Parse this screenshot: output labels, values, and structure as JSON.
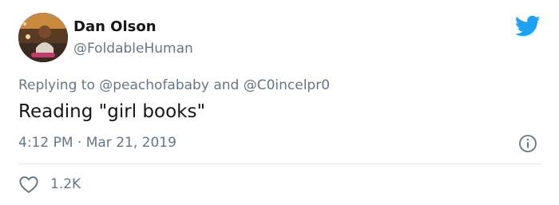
{
  "author": {
    "name": "Dan Olson",
    "handle": "@FoldableHuman"
  },
  "reply": {
    "prefix": "Replying to",
    "mention1": "@peachofababy",
    "conjunction": "and",
    "mention2": "@C0incelpr0"
  },
  "tweet": {
    "text": "Reading \"girl books\""
  },
  "meta": {
    "time": "4:12 PM",
    "separator": "·",
    "date": "Mar 21, 2019"
  },
  "stats": {
    "likes": "1.2K"
  },
  "icons": {
    "brand": "twitter-bird-icon",
    "info": "info-icon",
    "like": "heart-icon"
  },
  "colors": {
    "brand": "#1da1f2",
    "muted": "#657786",
    "text": "#14171a",
    "divider": "#e1e8ed"
  }
}
